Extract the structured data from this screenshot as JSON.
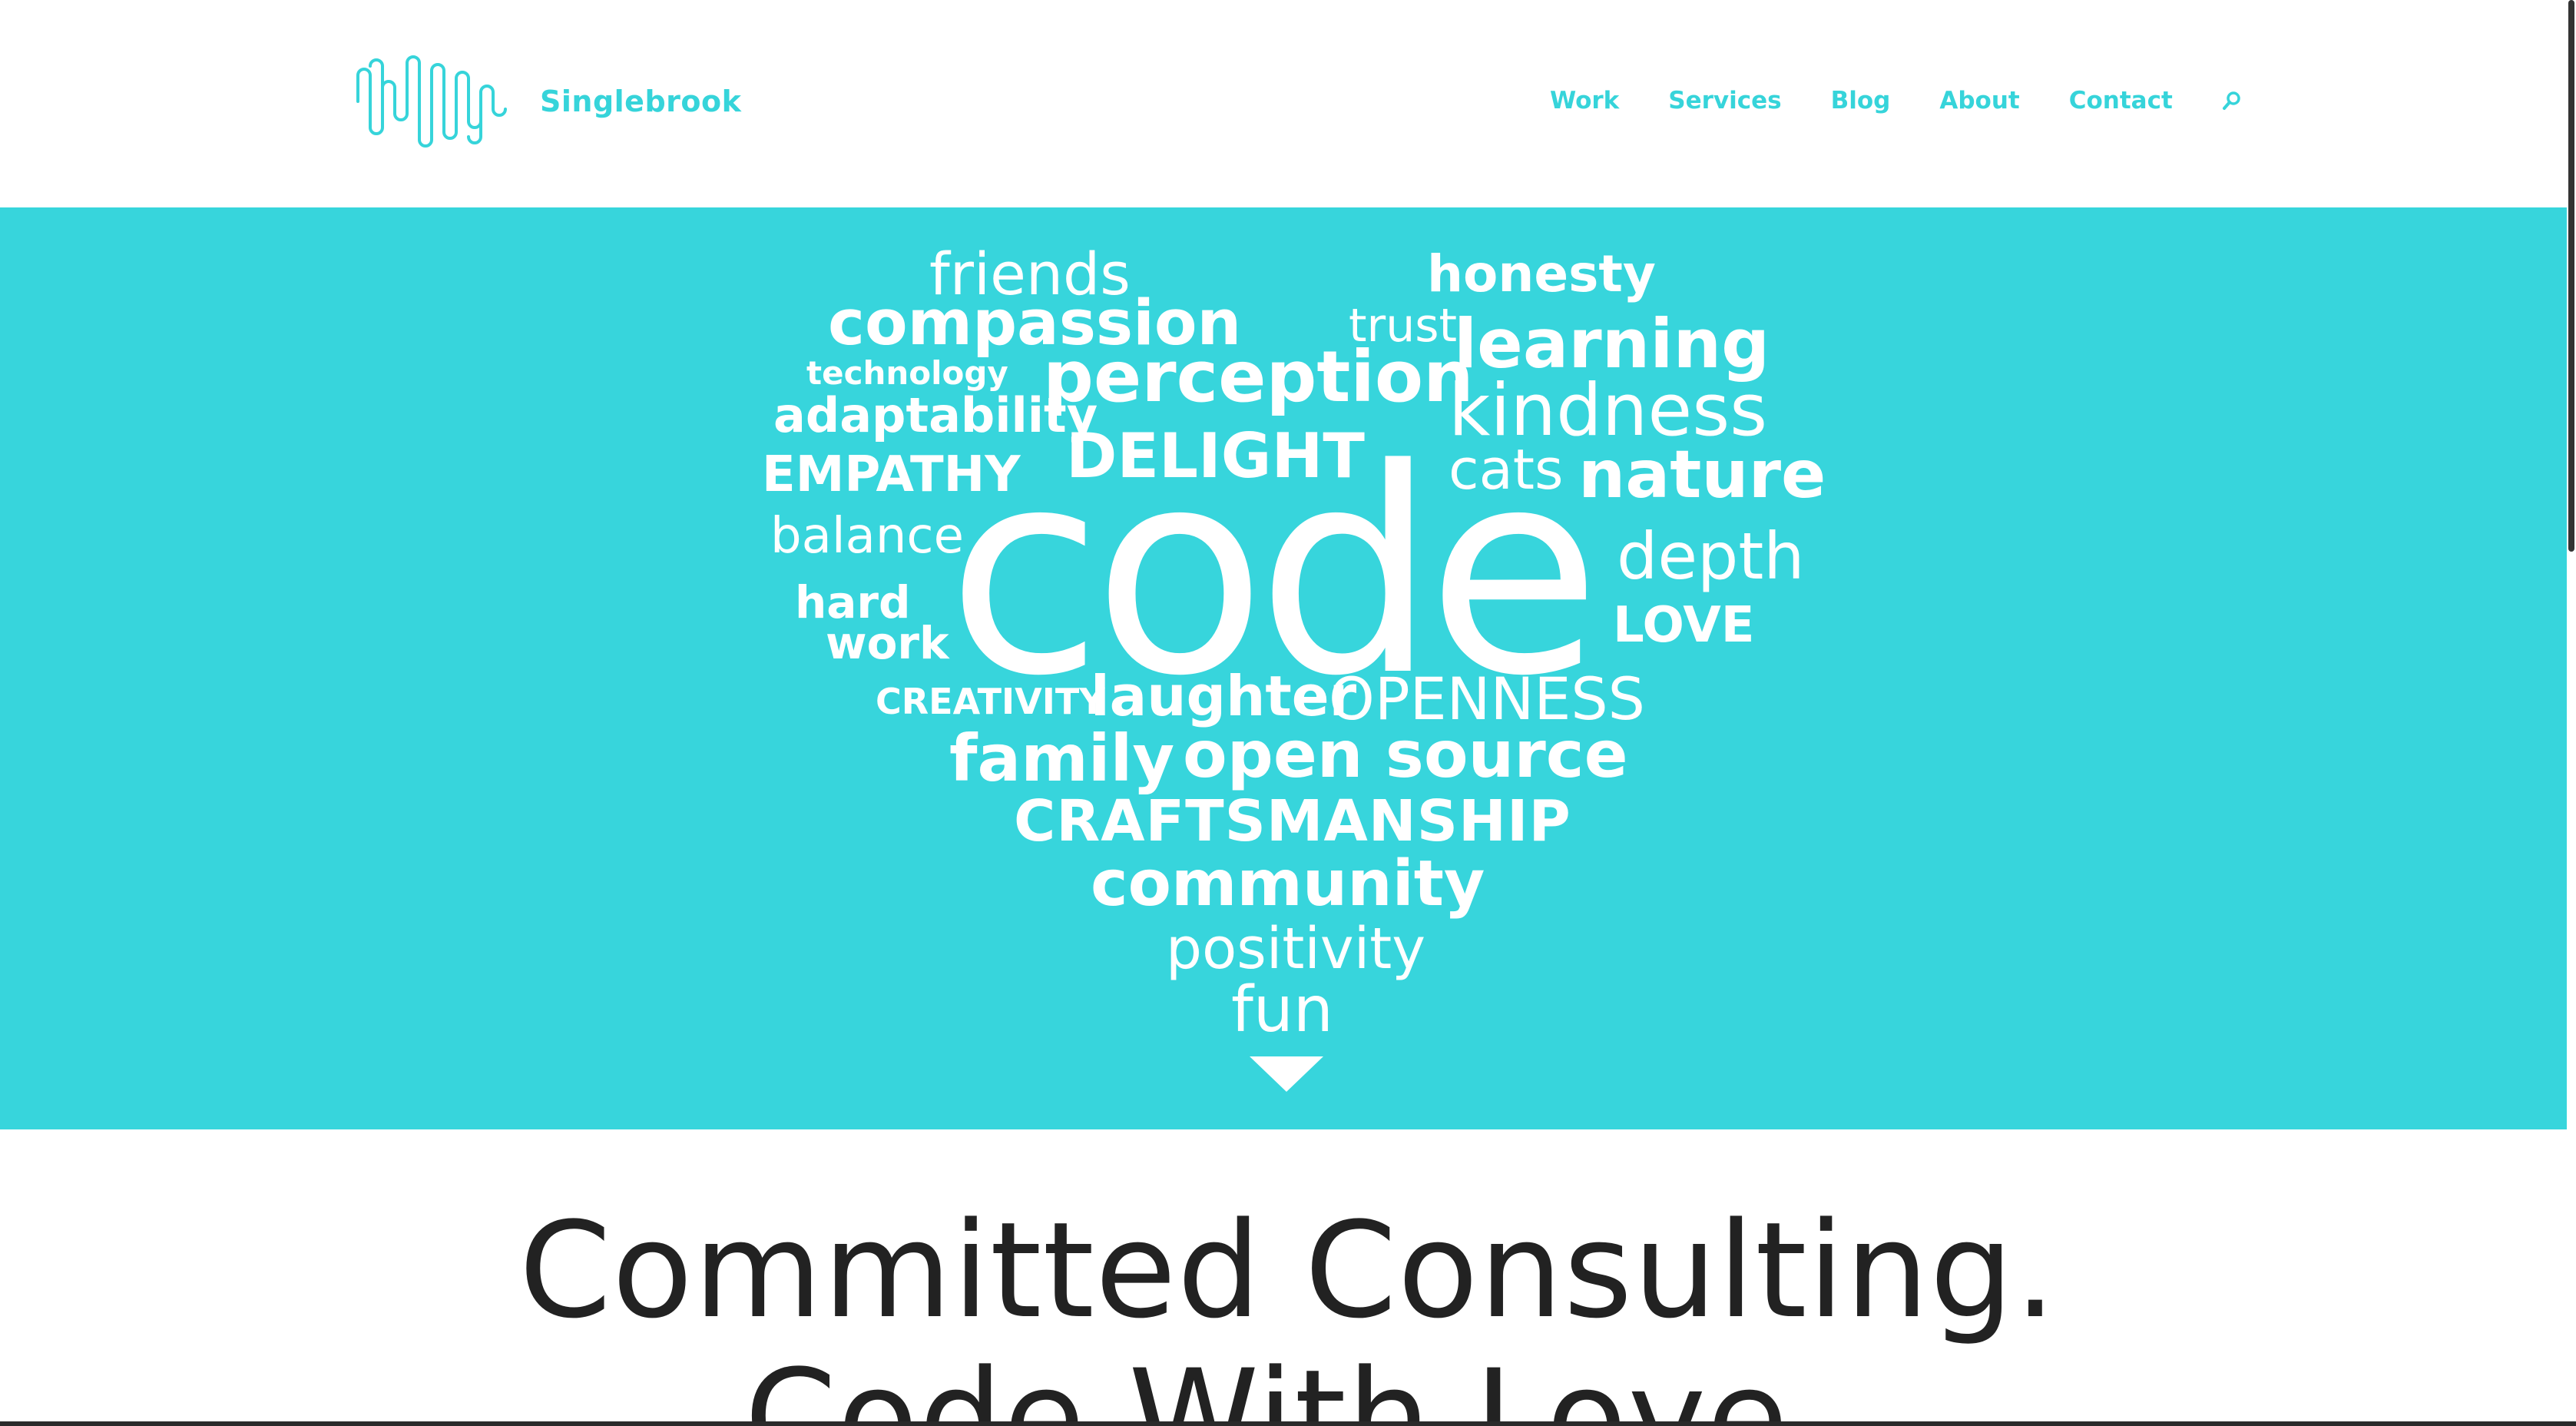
{
  "site": {
    "brand_name": "Singlebrook"
  },
  "nav": {
    "items": [
      {
        "label": "Work"
      },
      {
        "label": "Services"
      },
      {
        "label": "Blog"
      },
      {
        "label": "About"
      },
      {
        "label": "Contact"
      }
    ],
    "search_icon": "search-icon"
  },
  "hero": {
    "words": [
      "friends",
      "honesty",
      "compassion",
      "trust",
      "learning",
      "technology",
      "perception",
      "adaptability",
      "kindness",
      "EMPATHY",
      "DELIGHT",
      "cats",
      "nature",
      "balance",
      "code",
      "depth",
      "hard",
      "work",
      "LOVE",
      "CREATIVITY",
      "laughter",
      "OPENNESS",
      "family",
      "open source",
      "CRAFTSMANSHIP",
      "community",
      "positivity",
      "fun"
    ],
    "scroll_icon": "triangle-down-icon"
  },
  "main": {
    "headline_lines": [
      "Committed Consulting.",
      "Code With Love."
    ]
  },
  "colors": {
    "accent": "#36d4da",
    "hero_bg": "#37d5dc",
    "text_dark": "#222222",
    "white": "#ffffff"
  }
}
